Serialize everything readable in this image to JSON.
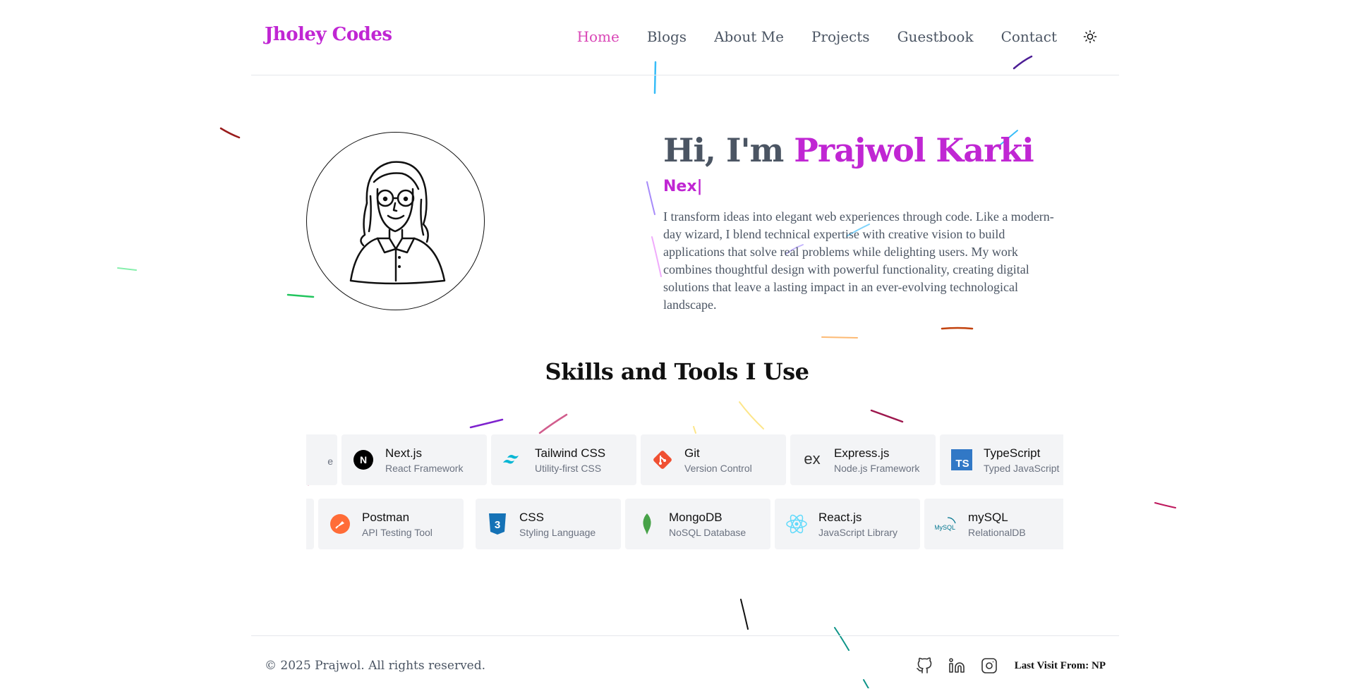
{
  "header": {
    "brand": "Jholey Codes",
    "nav": [
      "Home",
      "Blogs",
      "About Me",
      "Projects",
      "Guestbook",
      "Contact"
    ],
    "active_nav": "Home",
    "theme_icon": "sun-icon"
  },
  "hero": {
    "greeting": "Hi, I'm",
    "name": "Prajwol Karki",
    "typed": "Nex",
    "cursor": "|",
    "bio": "I transform ideas into elegant web experiences through code. Like a modern-day wizard, I blend technical expertise with creative vision to build applications that solve real problems while delighting users. My work combines thoughtful design with powerful functionality, creating digital solutions that leave a lasting impact in an ever-evolving technological landscape.",
    "avatar_icon": "avatar-illustration"
  },
  "skills": {
    "title": "Skills and Tools I Use",
    "row1": [
      {
        "name": "",
        "desc": "e",
        "icon": "blank-icon"
      },
      {
        "name": "Next.js",
        "desc": "React Framework",
        "icon": "nextjs-icon"
      },
      {
        "name": "Tailwind CSS",
        "desc": "Utility-first CSS",
        "icon": "tailwind-icon"
      },
      {
        "name": "Git",
        "desc": "Version Control",
        "icon": "git-icon"
      },
      {
        "name": "Express.js",
        "desc": "Node.js Framework",
        "icon": "express-icon"
      },
      {
        "name": "TypeScript",
        "desc": "Typed JavaScript",
        "icon": "typescript-icon"
      }
    ],
    "row2": [
      {
        "name": "",
        "desc": "",
        "icon": "blank-icon"
      },
      {
        "name": "Postman",
        "desc": "API Testing Tool",
        "icon": "postman-icon"
      },
      {
        "name": "CSS",
        "desc": "Styling Language",
        "icon": "css-icon"
      },
      {
        "name": "MongoDB",
        "desc": "NoSQL Database",
        "icon": "mongodb-icon"
      },
      {
        "name": "React.js",
        "desc": "JavaScript Library",
        "icon": "react-icon"
      },
      {
        "name": "mySQL",
        "desc": "RelationalDB",
        "icon": "mysql-icon"
      }
    ]
  },
  "footer": {
    "copyright": "© 2025 Prajwol. All rights reserved.",
    "socials": [
      "github-icon",
      "linkedin-icon",
      "instagram-icon"
    ],
    "last_visit": "Last Visit From: NP"
  },
  "colors": {
    "accent": "#c026d3",
    "text": "#4b5563",
    "card_bg": "#f3f4f6"
  }
}
